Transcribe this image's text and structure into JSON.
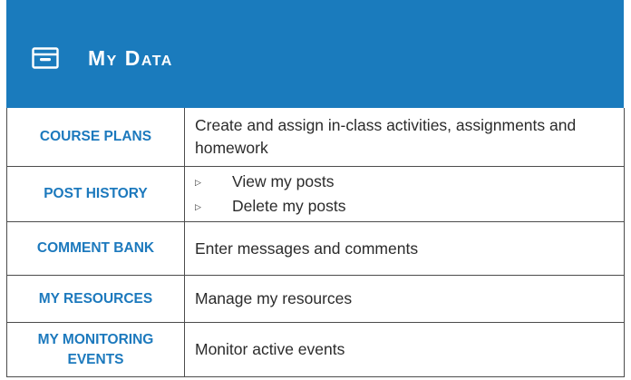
{
  "header": {
    "title": "My Data",
    "icon": "archive-box-icon",
    "background_color": "#1a7bbd",
    "label_color": "#1c79bd"
  },
  "rows": [
    {
      "label": "COURSE PLANS",
      "description": "Create and assign in-class activities, assignments and homework"
    },
    {
      "label": "POST HISTORY",
      "bullets": [
        "View my posts",
        "Delete my posts"
      ],
      "bullet_icon": "triangle-right-icon"
    },
    {
      "label": "COMMENT BANK",
      "description": "Enter messages and comments"
    },
    {
      "label": "MY RESOURCES",
      "description": "Manage my resources"
    },
    {
      "label": "MY MONITORING EVENTS",
      "description": "Monitor active events"
    }
  ]
}
